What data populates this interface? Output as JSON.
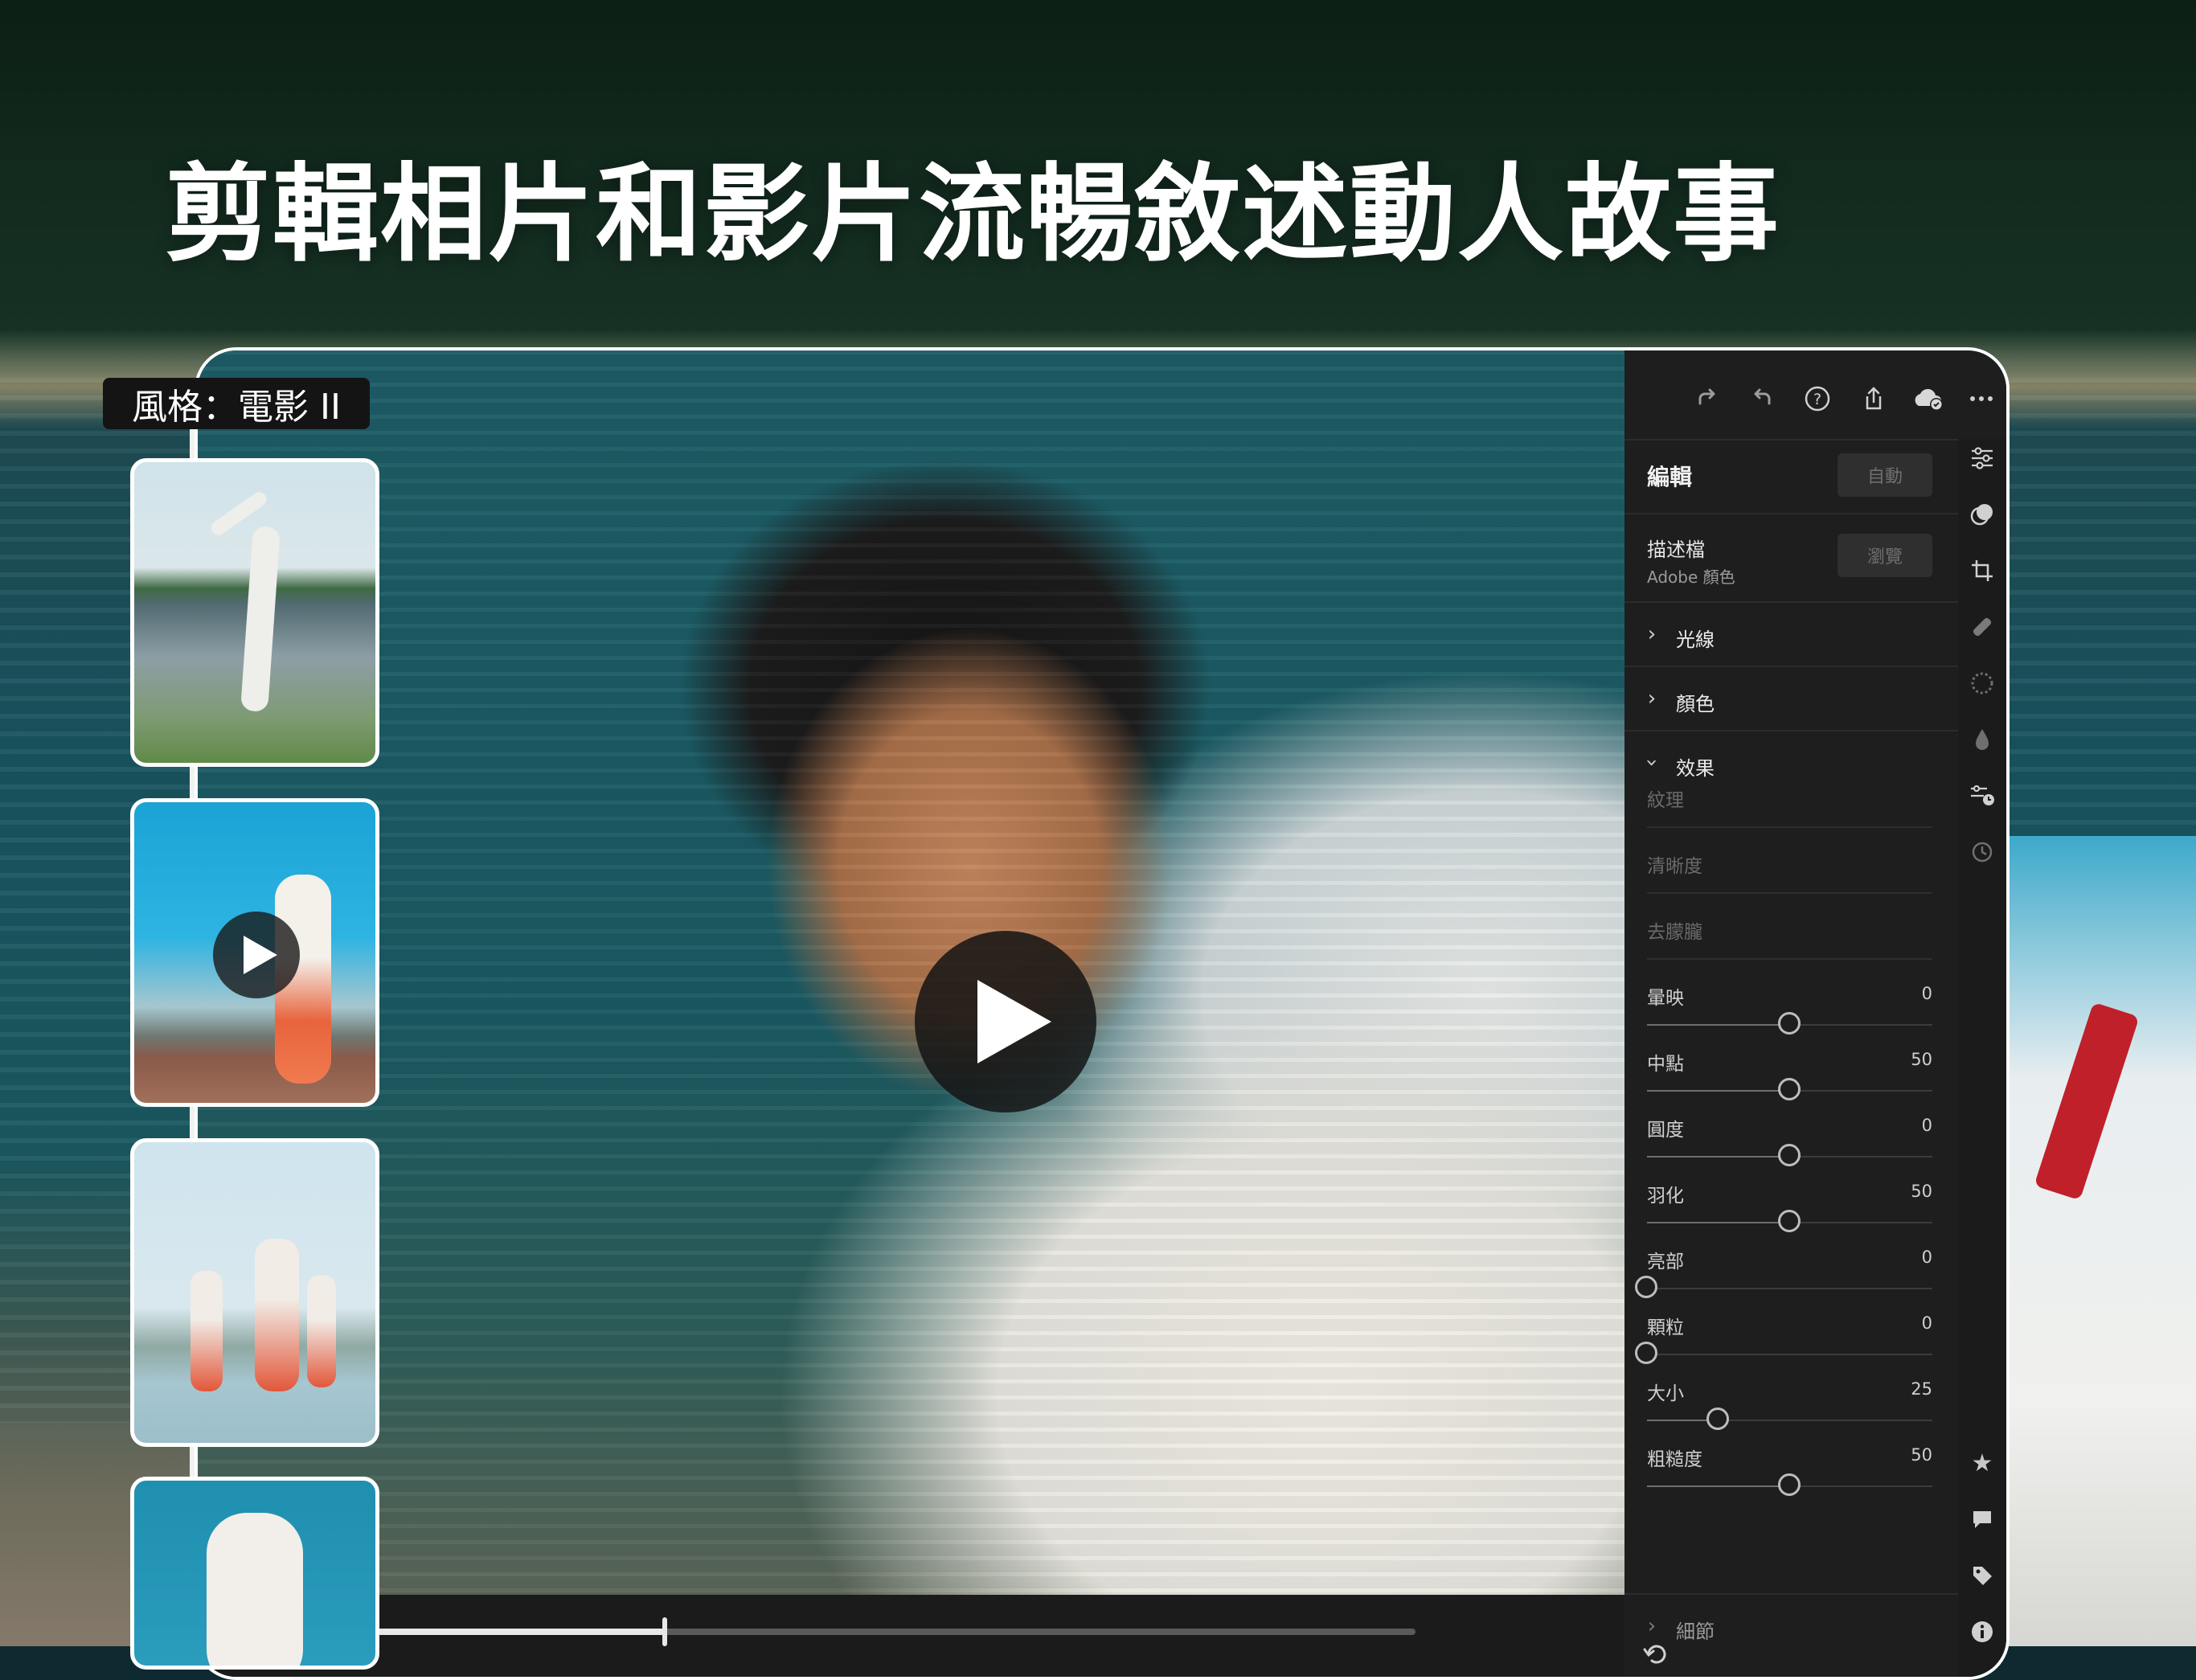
{
  "headline": "剪輯相片和影片流暢敘述動人故事",
  "style_label": "風格：電影 II",
  "editor": {
    "toolbar_icons": [
      "redo-icon",
      "undo-icon",
      "help-icon",
      "share-icon",
      "cloud-synced-icon",
      "more-icon"
    ],
    "edit": {
      "title": "編輯",
      "auto_button": "自動"
    },
    "profile": {
      "label": "描述檔",
      "value": "Adobe 顏色",
      "browse_button": "瀏覽"
    },
    "sections": {
      "light": "光線",
      "color": "顏色",
      "effects": "效果",
      "detail": "細節"
    },
    "disabled_sliders": [
      "紋理",
      "清晰度",
      "去朦朧"
    ],
    "sliders": [
      {
        "name": "暈映",
        "value": "0",
        "position": 0.5
      },
      {
        "name": "中點",
        "value": "50",
        "position": 0.5
      },
      {
        "name": "圓度",
        "value": "0",
        "position": 0.5
      },
      {
        "name": "羽化",
        "value": "50",
        "position": 0.5
      },
      {
        "name": "亮部",
        "value": "0",
        "position": 0.0
      },
      {
        "name": "顆粒",
        "value": "0",
        "position": 0.0
      },
      {
        "name": "大小",
        "value": "25",
        "position": 0.25
      },
      {
        "name": "粗糙度",
        "value": "50",
        "position": 0.5
      }
    ],
    "rail_icons_top": [
      "adjust-sliders-icon",
      "presets-icon",
      "crop-icon",
      "healing-brush-icon",
      "masking-icon",
      "color-drop-icon",
      "versions-icon",
      "history-icon"
    ],
    "rail_icons_bottom": [
      "star-rating-icon",
      "comment-icon",
      "tag-icon",
      "info-icon"
    ]
  },
  "video": {
    "progress": 0.34
  },
  "colors": {
    "accent": "#ffffff",
    "panel": "#1e1e1e",
    "sash_red": "#c0202a"
  }
}
